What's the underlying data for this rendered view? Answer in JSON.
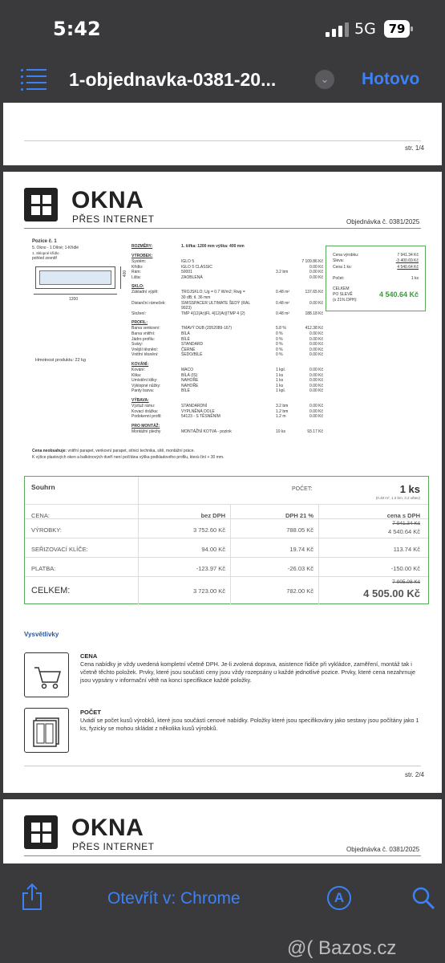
{
  "status_bar": {
    "time": "5:42",
    "network": "5G",
    "battery": "79"
  },
  "nav": {
    "title": "1-objednavka-0381-20...",
    "done": "Hotovo"
  },
  "page1": {
    "page_number": "str. 1/4"
  },
  "page2": {
    "logo_word": "OKNA",
    "logo_sub": "PŘES INTERNET",
    "order_number": "Objednávka č. 0381/2025",
    "position": {
      "title": "Pozice č. 1",
      "desc1": "5. Okno - 1 Dílné; 1-Křídlé",
      "desc2": "1. Sklopné křídlo",
      "view": "pohled zevnitř",
      "height": "400",
      "width": "1200",
      "weight": "Hmotnost produktu: 22 kg"
    },
    "rozmery": {
      "label": "ROZMĚRY:",
      "value": "1. šířka: 1200 mm    výška: 400 mm"
    },
    "spec_sections": [
      {
        "title": "VÝROBEK:",
        "rows": [
          [
            "Systém:",
            "IGLO 5",
            "",
            "7 109.86 Kč"
          ],
          [
            "Křídlo:",
            "IGLO 5 CLASSIC",
            "",
            "0.00 Kč"
          ],
          [
            "Rám:",
            "50001",
            "3.2 bm",
            "0.00 Kč"
          ],
          [
            "Lišta:",
            "ZAOBLENÁ",
            "",
            "0.00 Kč"
          ]
        ]
      },
      {
        "title": "SKLO:",
        "rows": [
          [
            "Základní výplň:",
            "TROJSKLO; Ug = 0.7 W/m2; Rwg =",
            "0.48 m²",
            "137.65 Kč"
          ],
          [
            "",
            "30 dB; tl. 36 mm",
            "",
            ""
          ],
          [
            "Distanční rámeček:",
            "SWISSPACER ULTIMATE ŠEDÝ (RAL",
            "0.48 m²",
            "0.00 Kč"
          ],
          [
            "",
            "9023)",
            "",
            ""
          ],
          [
            "Složení:",
            "TMP 4|12(Ar)|FL 4|12(Ar)|TMP 4 (2)",
            "0.48 m²",
            "188.18 Kč"
          ]
        ]
      },
      {
        "title": "PROFIL:",
        "rows": [
          [
            "Barva venkovní:",
            "TMAVÝ DUB (2052089-167)",
            "5.8 %",
            "412.38 Kč"
          ],
          [
            "Barva vnitřní:",
            "BÍLÁ",
            "0 %",
            "0.00 Kč"
          ],
          [
            "Jádro profilu:",
            "BÍLÉ",
            "0 %",
            "0.00 Kč"
          ],
          [
            "Sváry:",
            "STANDARD",
            "0 %",
            "0.00 Kč"
          ],
          [
            "Vnější těsnění:",
            "ČERNÉ",
            "0 %",
            "0.00 Kč"
          ],
          [
            "Vnitřní těsnění:",
            "ŠEDO/BÍLÉ",
            "0 %",
            "0.00 Kč"
          ]
        ]
      },
      {
        "title": "KOVÁNÍ:",
        "rows": [
          [
            "Kování:",
            "MACO",
            "1 kpl.",
            "0.00 Kč"
          ],
          [
            "Klika:",
            "BÍLÁ (IS)",
            "1 ks",
            "0.00 Kč"
          ],
          [
            "Umístění kliky:",
            "NAHOŘE",
            "1 ks",
            "0.00 Kč"
          ],
          [
            "Výklopné nůžky:",
            "NAHOŘE",
            "1 ks",
            "0.00 Kč"
          ],
          [
            "Panty barva:",
            "BÍLÉ",
            "1 kpl.",
            "0.00 Kč"
          ]
        ]
      },
      {
        "title": "VÝBAVA:",
        "rows": [
          [
            "Výztuž rámu:",
            "STANDARDNÍ",
            "3.2 bm",
            "0.00 Kč"
          ],
          [
            "Kovací drážka:",
            "VYPLNĚNÁ DOLE",
            "1.2 bm",
            "0.00 Kč"
          ],
          [
            "Podokenní profil:",
            "54123 - S TĚSNĚNÍM",
            "1.2 m",
            "0.00 Kč"
          ]
        ]
      },
      {
        "title": "PRO MONTÁŽ:",
        "rows": [
          [
            "Montážní plechy",
            "MONTÁŽNÍ KOTVA - pozink",
            "10 ks",
            "93.17 Kč"
          ]
        ]
      }
    ],
    "price_box": {
      "vyrobku_label": "Cena výrobku:",
      "vyrobku_value": "7 941.34 Kč",
      "sleva_label": "Sleva:",
      "sleva_value": "-3 400.69 Kč",
      "cena1_label": "Cena 1 ks:",
      "cena1_value": "4 540.64 Kč",
      "pocet_label": "Počet:",
      "pocet_value": "1 ks",
      "celkem_label1": "CELKEM",
      "celkem_label2": "PO SLEVĚ",
      "celkem_label3": "(s 21% DPH):",
      "celkem_value": "4 540.64 Kč"
    },
    "note_bold": "Cena neobsahuje:",
    "note1": " vnitřní parapet, venkovní parapet, stínicí technika, sítě, montážní práce.",
    "note2": "K výšce plastových oken a balkónových dveří není počítána výška podkladového profilu, která činí + 30 mm.",
    "summary": {
      "title": "Souhrn",
      "pocet_label": "POČET:",
      "pocet_value": "1 ks",
      "pocet_sub": "(0.48 m², 1.2 bm, 3.2 větev)",
      "header": [
        "CENA:",
        "bez DPH",
        "DPH 21 %",
        "cena s DPH"
      ],
      "rows": [
        {
          "label": "VÝROBKY:",
          "bez": "3 752.60 Kč",
          "dph": "788.05 Kč",
          "s_old": "7 941.34 Kč",
          "s": "4 540.64 Kč"
        },
        {
          "label": "SEŘIZOVACÍ KLÍČE:",
          "bez": "94.00 Kč",
          "dph": "19.74 Kč",
          "s_old": "",
          "s": "113.74 Kč"
        },
        {
          "label": "PLATBA:",
          "bez": "-123.97 Kč",
          "dph": "-26.03 Kč",
          "s_old": "",
          "s": "-150.00 Kč"
        }
      ],
      "total": {
        "label": "CELKEM:",
        "bez": "3 723.00 Kč",
        "dph": "782.00 Kč",
        "s_old": "7 905.08 Kč",
        "s": "4 505.00 Kč"
      }
    },
    "legend": {
      "title": "Vysvětlivky",
      "items": [
        {
          "heading": "CENA",
          "text": "Cena nabídky je vždy uvedená kompletní včetně DPH. Je-li zvolená doprava, asistence řidiče při vykládce, zaměření, montáž tak i včetně těchto položek. Prvky, které jsou součástí ceny jsou vždy rozepsány u každé jednotlivé pozice. Prvky, které cena nezahrnuje jsou vypsány v informační větě na konci specifikace každé položky."
        },
        {
          "heading": "POČET",
          "text": "Uvádí se počet kusů výrobků, které jsou součástí cenové nabídky. Položky které jsou specifikovány jako sestavy jsou počítány jako 1 ks, fyzicky se mohou skládat z několika kusů výrobků."
        }
      ]
    },
    "page_number": "str. 2/4"
  },
  "page3": {
    "logo_word": "OKNA",
    "logo_sub": "PŘES INTERNET",
    "order_number": "Objednávka č. 0381/2025"
  },
  "toolbar": {
    "open_in": "Otevřít v: Chrome"
  },
  "watermark": "@( Bazos.cz",
  "colors": {
    "accent": "#3b82f6",
    "green": "#3a9a3a"
  }
}
